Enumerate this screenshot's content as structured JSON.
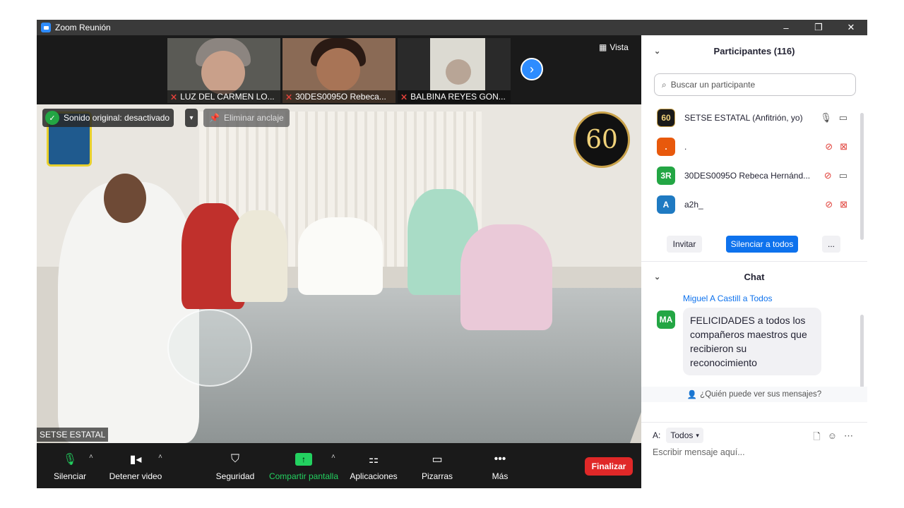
{
  "window": {
    "title": "Zoom Reunión",
    "controls": [
      "–",
      "❐",
      "✕"
    ]
  },
  "thumbnails": [
    {
      "name": "LUZ DEL CARMEN LO..."
    },
    {
      "name": "30DES0095O  Rebeca..."
    },
    {
      "name": "BALBINA REYES GON..."
    }
  ],
  "view_label": "Vista",
  "main_video": {
    "sound_label": "Sonido original: desactivado",
    "unpin_label": "Eliminar anclaje",
    "logo_60": "60",
    "speaker_name": "SETSE ESTATAL"
  },
  "toolbar": {
    "mute": "Silenciar",
    "stop_video": "Detener video",
    "security": "Seguridad",
    "share": "Compartir pantalla",
    "apps": "Aplicaciones",
    "whiteboards": "Pizarras",
    "more": "Más",
    "end": "Finalizar"
  },
  "participants": {
    "title": "Participantes (116)",
    "search_placeholder": "Buscar un participante",
    "list": [
      {
        "avatar": "60",
        "color": "#1a1a1a",
        "name": "SETSE ESTATAL (Anfitrión, yo)"
      },
      {
        "avatar": ".",
        "color": "#e8590c",
        "name": "."
      },
      {
        "avatar": "3R",
        "color": "#23a644",
        "name": "30DES0095O  Rebeca Hernánd..."
      },
      {
        "avatar": "A",
        "color": "#1f7ac2",
        "name": "a2h_"
      }
    ],
    "invite": "Invitar",
    "mute_all": "Silenciar a todos",
    "more": "..."
  },
  "chat": {
    "title": "Chat",
    "message": {
      "from": "Miguel A Castill a Todos",
      "avatar": "MA",
      "text": "FELICIDADES a todos los compañeros maestros que recibieron su reconocimiento"
    },
    "who_sees": "¿Quién puede ver sus mensajes?",
    "to_label": "A:",
    "to_value": "Todos",
    "input_placeholder": "Escribir mensaje aquí..."
  },
  "colors": {
    "accent": "#2d8cff",
    "share_green": "#23d160",
    "end_red": "#e02828",
    "muted_red": "#e0413a"
  }
}
